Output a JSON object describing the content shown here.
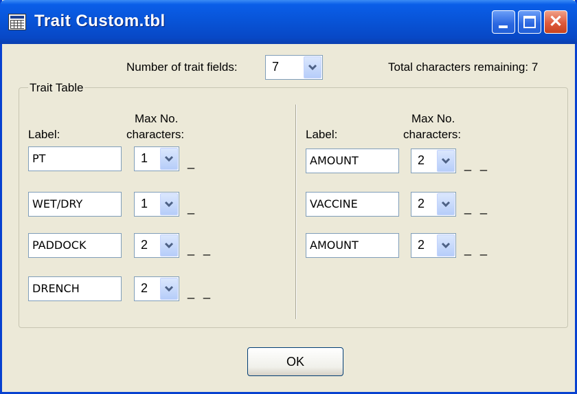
{
  "window": {
    "title": "Trait Custom.tbl"
  },
  "header": {
    "num_fields_label": "Number of trait fields:",
    "num_fields_value": "7",
    "remaining_label": "Total characters remaining: 7"
  },
  "trait_table": {
    "title": "Trait Table",
    "label_header": "Label:",
    "max_header_line1": "Max No.",
    "max_header_line2": "characters:",
    "left_rows": [
      {
        "label": "PT",
        "max": "1",
        "dashes": "_"
      },
      {
        "label": "WET/DRY",
        "max": "1",
        "dashes": "_"
      },
      {
        "label": "PADDOCK",
        "max": "2",
        "dashes": "_ _"
      },
      {
        "label": "DRENCH",
        "max": "2",
        "dashes": "_ _"
      }
    ],
    "right_rows": [
      {
        "label": "AMOUNT",
        "max": "2",
        "dashes": "_ _"
      },
      {
        "label": "VACCINE",
        "max": "2",
        "dashes": "_ _"
      },
      {
        "label": "AMOUNT",
        "max": "2",
        "dashes": "_ _"
      }
    ]
  },
  "buttons": {
    "ok": "OK"
  }
}
